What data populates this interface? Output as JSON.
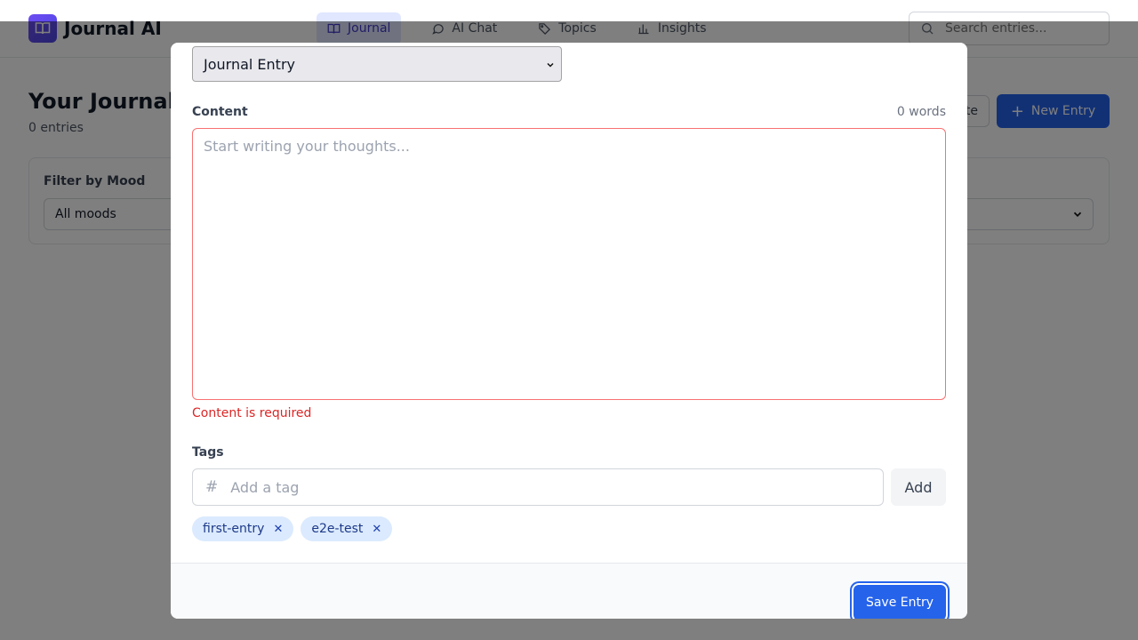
{
  "app": {
    "title": "Journal AI",
    "logo_icon": "book-open-icon"
  },
  "nav": [
    {
      "label": "Journal",
      "icon": "book-open-icon",
      "active": true
    },
    {
      "label": "AI Chat",
      "icon": "chat-bubble-icon"
    },
    {
      "label": "Topics",
      "icon": "tag-icon"
    },
    {
      "label": "Insights",
      "icon": "bar-chart-icon"
    }
  ],
  "search": {
    "placeholder": "Search entries..."
  },
  "page": {
    "title": "Your Journal",
    "count": "0 entries",
    "template_button_visible": "te",
    "new_entry_label": "New Entry"
  },
  "filter": {
    "label": "Filter by Mood",
    "value": "All moods"
  },
  "modal": {
    "entry_type": "Journal Entry",
    "content_label": "Content",
    "word_count": "0 words",
    "content_placeholder": "Start writing your thoughts...",
    "error": "Content is required",
    "tags_label": "Tags",
    "tag_placeholder": "Add a tag",
    "add_label": "Add",
    "tags": [
      "first-entry",
      "e2e-test"
    ],
    "save_label": "Save Entry"
  },
  "colors": {
    "accent": "#2563eb",
    "error": "#dc2626",
    "chip_bg": "#dbeafe"
  }
}
